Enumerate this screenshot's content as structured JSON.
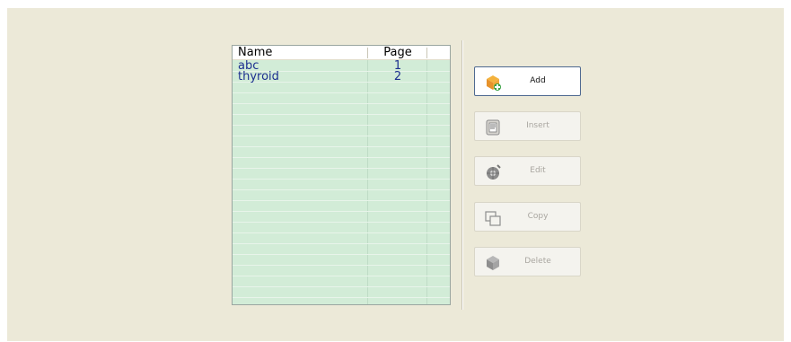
{
  "list": {
    "headers": {
      "name": "Name",
      "page": "Page"
    },
    "rows": [
      {
        "name": "abc",
        "page": "1"
      },
      {
        "name": "thyroid",
        "page": "2"
      }
    ]
  },
  "buttons": {
    "add": {
      "label": "Add",
      "icon": "add-box-icon"
    },
    "insert": {
      "label": "Insert",
      "icon": "insert-document-icon"
    },
    "edit": {
      "label": "Edit",
      "icon": "edit-wheel-icon"
    },
    "copy": {
      "label": "Copy",
      "icon": "copy-windows-icon"
    },
    "delete": {
      "label": "Delete",
      "icon": "delete-box-icon"
    }
  },
  "colors": {
    "panel_background": "#ece9d8",
    "list_background": "#d2ecd7",
    "list_text": "#1c2f8f",
    "active_button_border": "#4f6a91"
  }
}
